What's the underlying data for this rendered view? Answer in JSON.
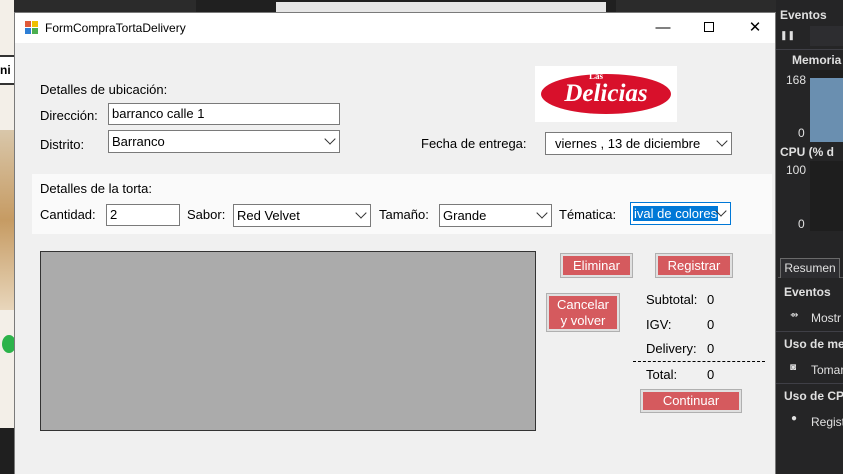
{
  "background": {
    "left_strip_text": "ni"
  },
  "window": {
    "title": "FormCompraTortaDelivery",
    "minimize_glyph": "—",
    "close_glyph": "✕"
  },
  "ubicacion": {
    "section_label": "Detalles de ubicación:",
    "direccion_label": "Dirección:",
    "direccion_value": "barranco calle 1",
    "distrito_label": "Distrito:",
    "distrito_value": "Barranco",
    "fecha_label": "Fecha de entrega:",
    "fecha_value": "viernes  , 13 de  diciembre"
  },
  "logo": {
    "small": "Las",
    "main": "Delicias"
  },
  "torta": {
    "section_label": "Detalles de la torta:",
    "cantidad_label": "Cantidad:",
    "cantidad_value": "2",
    "sabor_label": "Sabor:",
    "sabor_value": "Red Velvet",
    "tamano_label": "Tamaño:",
    "tamano_value": "Grande",
    "tematica_label": "Tématica:",
    "tematica_value": "ival de colores"
  },
  "buttons": {
    "eliminar": "Eliminar",
    "registrar": "Registrar",
    "cancelar_line1": "Cancelar",
    "cancelar_line2": "y volver",
    "continuar": "Continuar"
  },
  "totals": {
    "subtotal_label": "Subtotal:",
    "subtotal_value": "0",
    "igv_label": "IGV:",
    "igv_value": "0",
    "delivery_label": "Delivery:",
    "delivery_value": "0",
    "total_label": "Total:",
    "total_value": "0"
  },
  "diagnostics": {
    "eventos_header": "Eventos",
    "pause_glyph": "❚❚",
    "memoria_header": "Memoria",
    "memoria_max": "168",
    "memoria_min": "0",
    "cpu_header": "CPU (% d",
    "cpu_max": "100",
    "cpu_min": "0",
    "tab_resumen": "Resumen",
    "eventos_section": "Eventos",
    "eventos_item": "Mostr",
    "uso_memoria_section": "Uso de mer",
    "uso_memoria_item": "Tomar",
    "uso_cpu_section": "Uso de CPU",
    "uso_cpu_item": "Regist",
    "colors": {
      "panel_bg": "#252526",
      "graph_fill": "#6a8fb0"
    }
  },
  "colors": {
    "button_red": "#d55a5e",
    "grid_gray": "#ababab",
    "logo_red": "#d8102b"
  }
}
